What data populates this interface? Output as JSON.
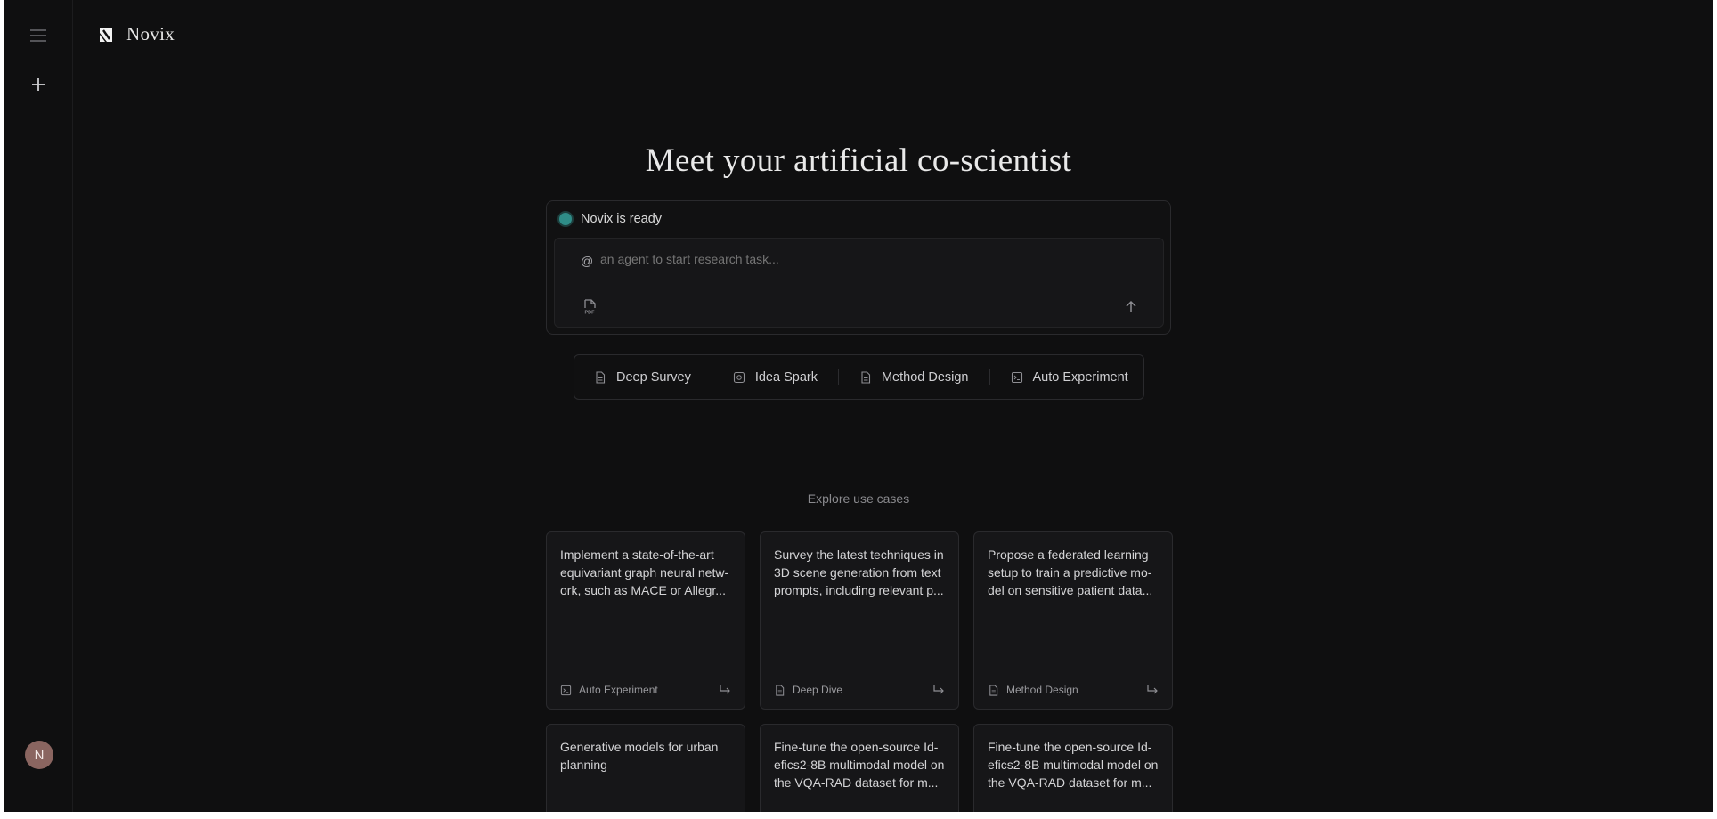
{
  "app": {
    "name": "Novix"
  },
  "hero": {
    "title": "Meet your artificial co-scientist"
  },
  "composer": {
    "status": "Novix is ready",
    "at_symbol": "@",
    "placeholder": "an agent to start research task..."
  },
  "modes": [
    {
      "label": "Deep Survey",
      "icon": "document-icon"
    },
    {
      "label": "Idea Spark",
      "icon": "spark-icon"
    },
    {
      "label": "Method Design",
      "icon": "document-icon"
    },
    {
      "label": "Auto Experiment",
      "icon": "terminal-icon"
    }
  ],
  "explore": {
    "label": "Explore use cases"
  },
  "cards": [
    {
      "text": "Implement a state-of-the-art equivariant graph neural netw-ork, such as MACE or Allegr...",
      "tag": "Auto Experiment",
      "icon": "terminal-icon"
    },
    {
      "text": "Survey the latest techniques in 3D scene generation from text prompts, including relevant p...",
      "tag": "Deep Dive",
      "icon": "document-icon"
    },
    {
      "text": "Propose a federated learning setup to train a predictive mo-del on sensitive patient data...",
      "tag": "Method Design",
      "icon": "document-icon"
    },
    {
      "text": "Generative models for urban planning",
      "tag": "",
      "icon": ""
    },
    {
      "text": "Fine-tune the open-source Id-efics2-8B multimodal model on the VQA-RAD dataset for m...",
      "tag": "",
      "icon": ""
    },
    {
      "text": "Fine-tune the open-source Id-efics2-8B multimodal model on the VQA-RAD dataset for m...",
      "tag": "",
      "icon": ""
    }
  ],
  "user": {
    "initial": "N"
  },
  "colors": {
    "background": "#0f0f10",
    "status_dot": "#2f8d88",
    "avatar": "#8a6560"
  }
}
